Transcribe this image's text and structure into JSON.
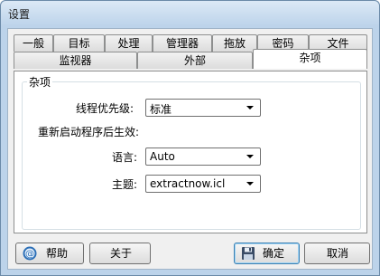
{
  "window": {
    "title": "设置"
  },
  "tabs_row1": [
    {
      "label": "一般"
    },
    {
      "label": "目标"
    },
    {
      "label": "处理"
    },
    {
      "label": "管理器"
    },
    {
      "label": "拖放"
    },
    {
      "label": "密码"
    },
    {
      "label": "文件"
    }
  ],
  "tabs_row2": [
    {
      "label": "监视器"
    },
    {
      "label": "外部"
    },
    {
      "label": "杂项",
      "selected": true
    }
  ],
  "group": {
    "title": "杂项",
    "priority_label": "线程优先级:",
    "priority_value": "标准",
    "restart_note": "重新启动程序后生效:",
    "language_label": "语言:",
    "language_value": "Auto",
    "theme_label": "主题:",
    "theme_value": "extractnow.icl"
  },
  "buttons": {
    "help": "帮助",
    "about": "关于",
    "ok": "确定",
    "cancel": "取消"
  },
  "icons": {
    "help": "help-at-icon",
    "ok": "save-disk-icon",
    "dropdown": "chevron-down-icon"
  },
  "colors": {
    "title_bar": "#bcd3ea",
    "default_button_border": "#3c7fb1"
  }
}
